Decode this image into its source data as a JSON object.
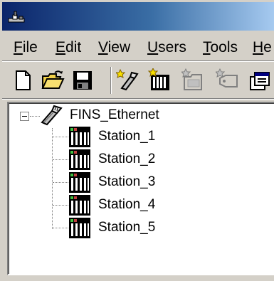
{
  "titlebar": {
    "icon": "app-icon"
  },
  "menu": {
    "items": [
      {
        "mnemonic": "F",
        "rest": "ile"
      },
      {
        "mnemonic": "E",
        "rest": "dit"
      },
      {
        "mnemonic": "V",
        "rest": "iew"
      },
      {
        "mnemonic": "U",
        "rest": "sers"
      },
      {
        "mnemonic": "T",
        "rest": "ools"
      },
      {
        "mnemonic": "H",
        "rest": "e"
      }
    ]
  },
  "toolbar": {
    "buttons": [
      {
        "icon": "new-document-icon"
      },
      {
        "icon": "open-folder-icon"
      },
      {
        "icon": "save-icon"
      },
      {
        "icon": "new-channel-icon"
      },
      {
        "icon": "new-device-icon"
      },
      {
        "icon": "new-tag-group-icon"
      },
      {
        "icon": "new-tag-icon"
      },
      {
        "icon": "properties-icon"
      }
    ]
  },
  "tree": {
    "root": {
      "label": "FINS_Ethernet",
      "icon": "ethernet-channel-icon",
      "expanded": true
    },
    "children": [
      {
        "label": "Station_1",
        "icon": "device-icon"
      },
      {
        "label": "Station_2",
        "icon": "device-icon"
      },
      {
        "label": "Station_3",
        "icon": "device-icon"
      },
      {
        "label": "Station_4",
        "icon": "device-icon"
      },
      {
        "label": "Station_5",
        "icon": "device-icon"
      }
    ]
  },
  "colors": {
    "titlebar_start": "#0a246a",
    "titlebar_end": "#a6caf0",
    "chrome": "#d4d0c8",
    "tree_background": "#ffffff"
  }
}
